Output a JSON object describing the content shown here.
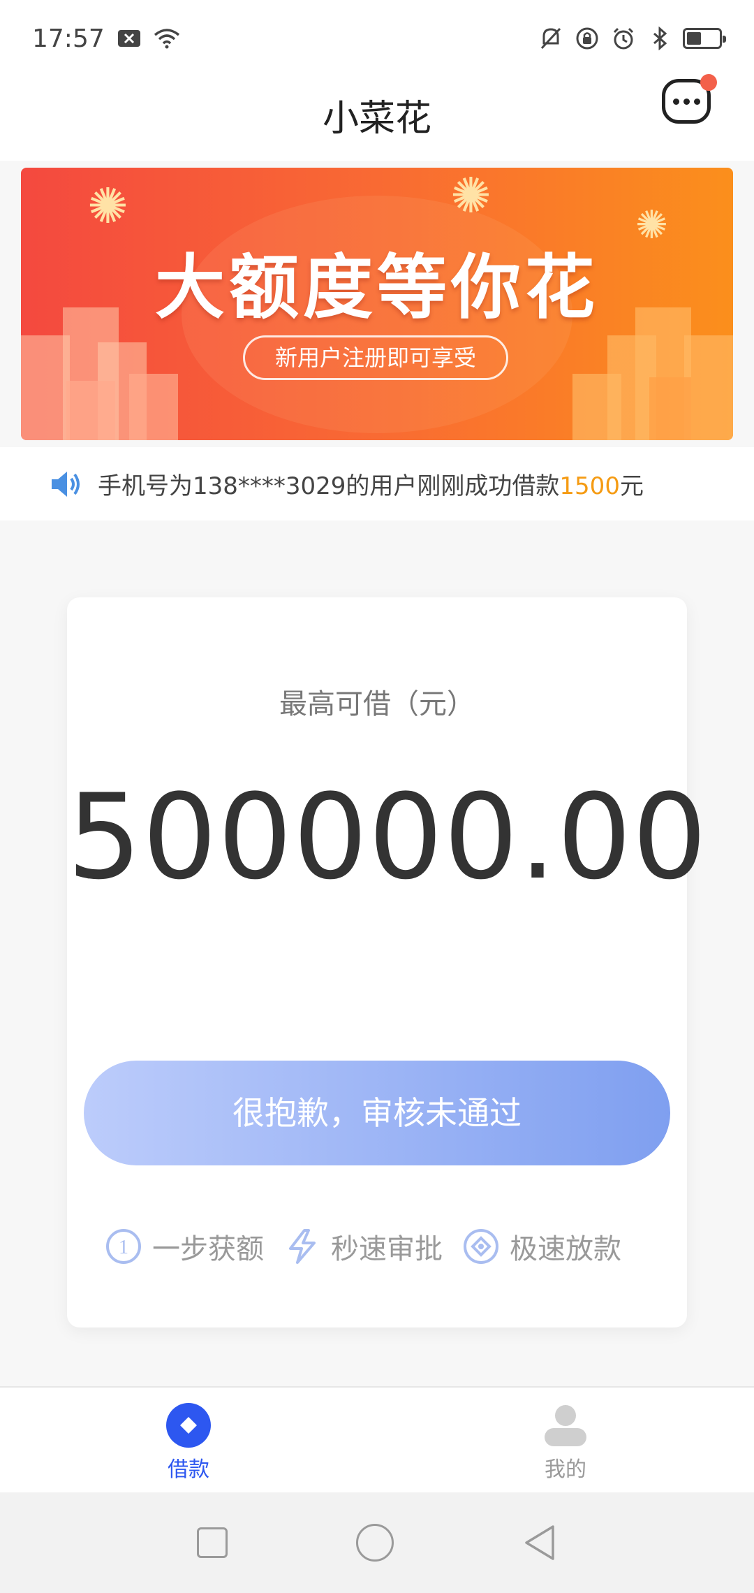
{
  "status_bar": {
    "time": "17:57"
  },
  "app": {
    "title": "小菜花"
  },
  "banner": {
    "title": "大额度等你花",
    "subtitle": "新用户注册即可享受"
  },
  "notice": {
    "prefix": "手机号为138****3029的用户刚刚成功借款",
    "amount": "1500",
    "suffix": "元"
  },
  "card": {
    "label": "最高可借（元）",
    "amount": "500000.00",
    "button": "很抱歉，审核未通过",
    "features": [
      {
        "icon": "step-one-icon",
        "label": "一步获额"
      },
      {
        "icon": "lightning-icon",
        "label": "秒速审批"
      },
      {
        "icon": "diamond-icon",
        "label": "极速放款"
      }
    ]
  },
  "tabs": [
    {
      "label": "借款",
      "icon": "loan-icon",
      "active": true
    },
    {
      "label": "我的",
      "icon": "profile-icon",
      "active": false
    }
  ],
  "colors": {
    "accent": "#2d57f0",
    "highlight": "#f59b13",
    "badge": "#f3604a"
  }
}
